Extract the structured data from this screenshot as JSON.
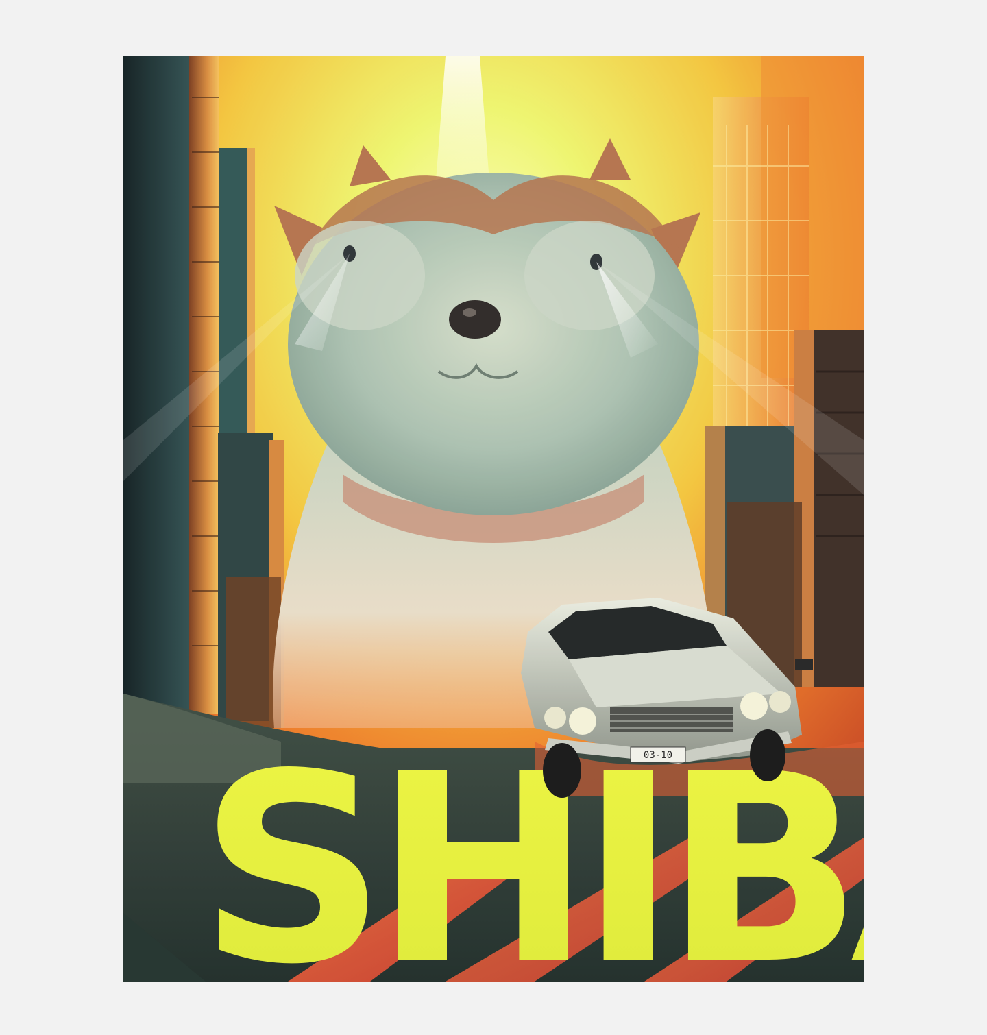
{
  "poster": {
    "title": "SHIBA",
    "title_color": "#e8f23a",
    "car_plate": "03-10",
    "background_color": "#f2f2f2",
    "accent_colors": {
      "glow_yellow": "#f4f36a",
      "fire_orange": "#f07a22",
      "fire_red": "#e0452a",
      "shadow_teal": "#27494a",
      "dog_fur": "#9fb7a6",
      "dog_ears": "#b3714a"
    }
  }
}
